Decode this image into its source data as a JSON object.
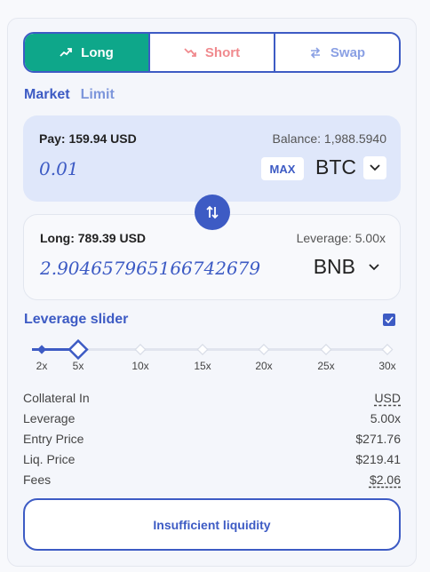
{
  "tabs": [
    {
      "label": "Long",
      "icon": "trend-up-icon"
    },
    {
      "label": "Short",
      "icon": "trend-down-icon"
    },
    {
      "label": "Swap",
      "icon": "swap-arrows-icon"
    }
  ],
  "mode": {
    "market": "Market",
    "limit": "Limit"
  },
  "pay": {
    "label": "Pay: 159.94 USD",
    "balance": "Balance: 1,988.5940",
    "amount": "0.01",
    "max": "MAX",
    "token": "BTC"
  },
  "receive": {
    "label": "Long: 789.39 USD",
    "leverage": "Leverage: 5.00x",
    "amount": "2.904657965166742679",
    "token": "BNB"
  },
  "leverage_slider": {
    "title": "Leverage slider",
    "checked": true,
    "marks": [
      "2x",
      "5x",
      "10x",
      "15x",
      "20x",
      "25x",
      "30x"
    ],
    "value": 5
  },
  "info": {
    "collateral_label": "Collateral In",
    "collateral_value": "USD",
    "leverage_label": "Leverage",
    "leverage_value": "5.00x",
    "entry_label": "Entry Price",
    "entry_value": "$271.76",
    "liq_label": "Liq. Price",
    "liq_value": "$219.41",
    "fees_label": "Fees",
    "fees_value": "$2.06"
  },
  "cta": "Insufficient liquidity",
  "colors": {
    "accent": "#3d5bc4",
    "long": "#0ea78a",
    "short": "#f08a8e"
  }
}
